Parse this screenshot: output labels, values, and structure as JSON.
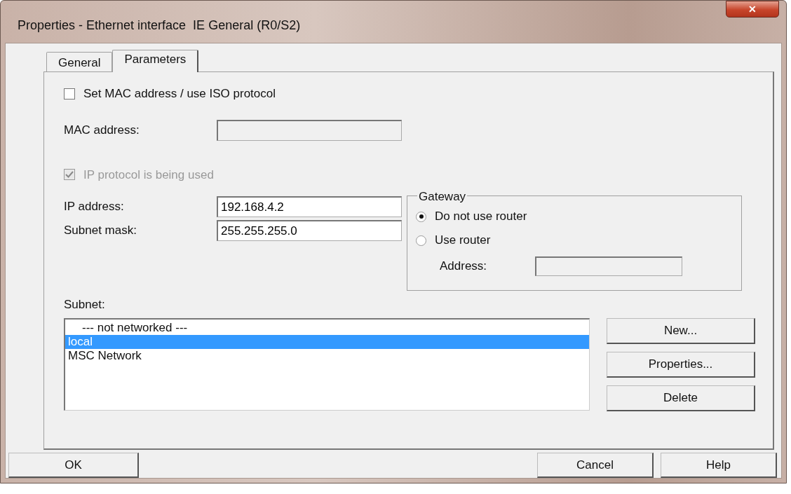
{
  "window": {
    "title": "Properties - Ethernet interface  IE General (R0/S2)",
    "close": "✕"
  },
  "tabs": [
    {
      "label": "General",
      "selected": false
    },
    {
      "label": "Parameters",
      "selected": true
    }
  ],
  "mac": {
    "checkbox": {
      "label": "Set MAC address / use ISO protocol",
      "checked": false
    },
    "label": "MAC address:",
    "disabled": true
  },
  "ip": {
    "checkbox": {
      "label": "IP protocol is being used",
      "checked": true,
      "disabled": true
    },
    "fields": [
      {
        "label": "IP address:",
        "value": "192.168.4.2"
      },
      {
        "label": "Subnet mask:",
        "value": "255.255.255.0"
      }
    ]
  },
  "gateway": {
    "title": "Gateway",
    "options": [
      {
        "label": "Do not use router",
        "selected": true
      },
      {
        "label": "Use router",
        "selected": false
      }
    ],
    "address_label": "Address:",
    "address_disabled": true
  },
  "subnet": {
    "label": "Subnet:",
    "items": [
      {
        "label": "--- not networked ---",
        "kind": "none",
        "selected": false
      },
      {
        "label": "local",
        "kind": "network",
        "selected": true
      },
      {
        "label": "MSC Network",
        "kind": "network",
        "selected": false
      }
    ],
    "buttons": [
      "New...",
      "Properties...",
      "Delete"
    ]
  },
  "footer": {
    "left": [
      "OK"
    ],
    "right": [
      "Cancel",
      "Help"
    ]
  }
}
